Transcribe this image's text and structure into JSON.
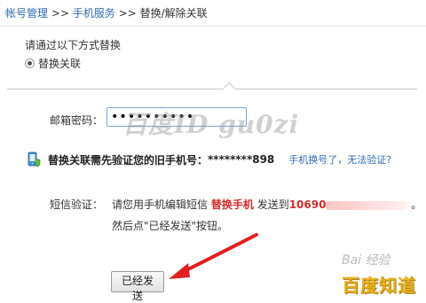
{
  "breadcrumb": {
    "items": [
      "帐号管理",
      "手机服务",
      "替换/解除关联"
    ],
    "separator": ">>"
  },
  "method": {
    "title": "请通过以下方式替换",
    "option": "替换关联"
  },
  "email": {
    "label": "邮箱密码：",
    "value": "••••••••••"
  },
  "watermark": "百度ID gu0zi",
  "verify": {
    "message": "替换关联需先验证您的旧手机号：",
    "number": "********898",
    "link": "手机换号了，无法验证?"
  },
  "sms": {
    "label": "短信验证：",
    "line1_prefix": "请您用手机编辑短信",
    "keyword": "替换手机",
    "line1_mid": "发送到",
    "number": "10690",
    "line1_suffix": "。",
    "line2": "然后点\"已经发送\"按钮。"
  },
  "send_button": "已经发送",
  "baidu": {
    "top": "Bai 经验",
    "bottom": "百度知道"
  },
  "colors": {
    "link": "#2f6bb3",
    "highlight": "#d62b2b",
    "arrow": "#e02020",
    "baidu": "#e8b21f"
  }
}
